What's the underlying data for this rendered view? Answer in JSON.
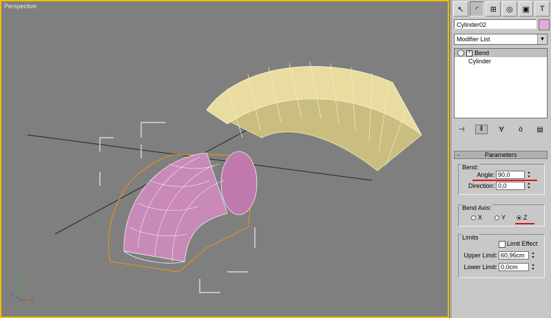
{
  "viewport": {
    "label": "Perspective",
    "axis_x": "x",
    "axis_y": "y",
    "axis_z": "z"
  },
  "command_panel": {
    "tabs": [
      {
        "icon": "create-arrow-icon",
        "glyph": "↖"
      },
      {
        "icon": "modify-arc-icon",
        "glyph": "◜"
      },
      {
        "icon": "hierarchy-icon",
        "glyph": "⊞"
      },
      {
        "icon": "motion-icon",
        "glyph": "◎"
      },
      {
        "icon": "display-icon",
        "glyph": "▣"
      },
      {
        "icon": "utilities-hammer-icon",
        "glyph": "T"
      }
    ],
    "object_name": "Cylinder02",
    "object_color": "#e6a8d8",
    "modifier_list": "Modifier List",
    "stack": [
      "Bend",
      "Cylinder"
    ],
    "parameters": {
      "title": "Parameters",
      "bend_group": "Bend:",
      "angle_label": "Angle:",
      "angle_value": "90,0",
      "direction_label": "Direction:",
      "direction_value": "0,0",
      "axis_group": "Bend Axis:",
      "axis_x": "X",
      "axis_y": "Y",
      "axis_z": "Z",
      "selected_axis": "Z",
      "limits_group": "Limits",
      "limit_effect": "Limit Effect",
      "upper_label": "Upper Limit:",
      "upper_value": "60,96cm",
      "lower_label": "Lower Limit:",
      "lower_value": "0,0cm"
    }
  },
  "colors": {
    "viewport_bg": "#7f7f7f",
    "active_border": "#f0c000",
    "highlight": "#e01010"
  }
}
